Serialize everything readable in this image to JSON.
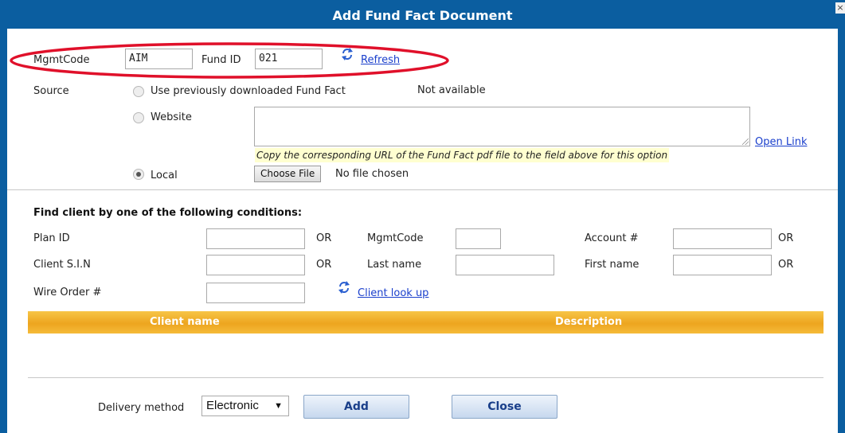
{
  "dialog": {
    "title": "Add Fund Fact Document",
    "close_glyph": "×"
  },
  "fund": {
    "mgmt_code_label": "MgmtCode",
    "mgmt_code_value": "AIM",
    "fund_id_label": "Fund ID",
    "fund_id_value": "021",
    "refresh_label": "Refresh"
  },
  "source": {
    "label": "Source",
    "options": {
      "previous": "Use previously downloaded Fund Fact",
      "website": "Website",
      "local": "Local"
    },
    "selected": "local",
    "previous_status": "Not available",
    "website_url": "",
    "website_hint": "Copy the corresponding URL of the Fund Fact pdf file to the field above for this option",
    "open_link_label": "Open Link",
    "choose_file_label": "Choose File",
    "file_status": "No file chosen"
  },
  "find_client": {
    "heading": "Find client by one of the following conditions:",
    "or_label": "OR",
    "fields": {
      "plan_id": {
        "label": "Plan ID",
        "value": ""
      },
      "mgmt_code": {
        "label": "MgmtCode",
        "value": ""
      },
      "account": {
        "label": "Account #",
        "value": ""
      },
      "client_sin": {
        "label": "Client S.I.N",
        "value": ""
      },
      "last_name": {
        "label": "Last name",
        "value": ""
      },
      "first_name": {
        "label": "First name",
        "value": ""
      },
      "wire_order": {
        "label": "Wire Order #",
        "value": ""
      }
    },
    "lookup_label": "Client look up"
  },
  "results": {
    "columns": [
      "Client name",
      "Description"
    ],
    "rows": []
  },
  "footer": {
    "delivery_label": "Delivery method",
    "delivery_selected": "Electronic",
    "delivery_arrow": "▼",
    "add_label": "Add",
    "close_label": "Close"
  },
  "colors": {
    "title_bar": "#0b5ea0",
    "grid_header": "#eda51f",
    "annotation_ellipse": "#e0102a",
    "link": "#1a3fcc"
  }
}
